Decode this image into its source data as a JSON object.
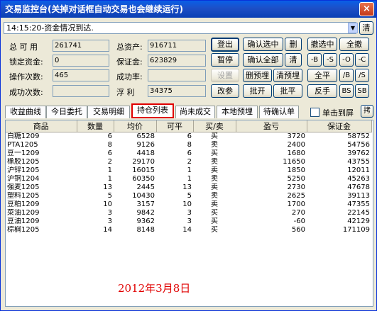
{
  "window": {
    "title": "交易监控台(关掉对话框自动交易也会继续运行)",
    "close_label": "×"
  },
  "status": {
    "text": "14:15:20-资金情况到达.",
    "clear_label": "清"
  },
  "account": {
    "available_label": "总 可 用",
    "available_value": "261741",
    "locked_label": "锁定资金:",
    "locked_value": "0",
    "ops_label": "操作次数:",
    "ops_value": "465",
    "success_label": "成功次数:",
    "success_value": "",
    "total_assets_label": "总资产:",
    "total_assets_value": "916711",
    "margin_label": "保证金:",
    "margin_value": "623829",
    "success_rate_label": "成功率:",
    "success_rate_value": "",
    "float_pnl_label": "浮  利",
    "float_pnl_value": "34375"
  },
  "buttons": {
    "login": "登出",
    "pause": "暂停",
    "settings": "设置",
    "change_params": "改参",
    "confirm_selected": "确认选中",
    "delete": "删",
    "confirm_all": "确认全部",
    "clear": "清",
    "delete_presets": "删预埋",
    "clear_presets": "清预埋",
    "batch_open": "批开",
    "batch_close": "批平",
    "cancel_selected": "撤选中",
    "cancel_all": "全撤",
    "minus_b": "-B",
    "minus_s": "-S",
    "minus_o": "-O",
    "minus_c": "-C",
    "close_all": "全平",
    "slash_b": "/B",
    "slash_s": "/S",
    "reverse": "反手",
    "bs": "BS",
    "sb": "SB"
  },
  "tabs": [
    {
      "label": "收益曲线"
    },
    {
      "label": "今日委托"
    },
    {
      "label": "交易明细"
    },
    {
      "label": "持仓列表"
    },
    {
      "label": "尚未成交"
    },
    {
      "label": "本地预埋"
    },
    {
      "label": "待确认单"
    }
  ],
  "single_sheet_label": "单击到屏",
  "pin_label": "拷",
  "table": {
    "columns": [
      "商品",
      "数量",
      "均价",
      "可平",
      "买/卖",
      "盈亏",
      "保证金"
    ],
    "rows": [
      [
        "白糖1209",
        "6",
        "6528",
        "6",
        "买",
        "3720",
        "58752"
      ],
      [
        "PTA1205",
        "8",
        "9126",
        "8",
        "卖",
        "2400",
        "54756"
      ],
      [
        "豆一1209",
        "6",
        "4418",
        "6",
        "买",
        "1680",
        "39762"
      ],
      [
        "橡胶1205",
        "2",
        "29170",
        "2",
        "卖",
        "11650",
        "43755"
      ],
      [
        "沪锌1205",
        "1",
        "16015",
        "1",
        "卖",
        "1850",
        "12011"
      ],
      [
        "沪铜1204",
        "1",
        "60350",
        "1",
        "卖",
        "5250",
        "45263"
      ],
      [
        "强麦1205",
        "13",
        "2445",
        "13",
        "卖",
        "2730",
        "47678"
      ],
      [
        "塑料1205",
        "5",
        "10430",
        "5",
        "卖",
        "2625",
        "39113"
      ],
      [
        "豆粕1209",
        "10",
        "3157",
        "10",
        "卖",
        "1700",
        "47355"
      ],
      [
        "菜油1209",
        "3",
        "9842",
        "3",
        "买",
        "270",
        "22145"
      ],
      [
        "豆油1209",
        "3",
        "9362",
        "3",
        "买",
        "-60",
        "42129"
      ],
      [
        "棕榈1205",
        "14",
        "8148",
        "14",
        "买",
        "560",
        "171109"
      ]
    ]
  },
  "annotation": "2012年3月8日",
  "colors": {
    "title_bar": "#0a5fe6",
    "annotation": "#e00000",
    "active_tab_border": "#e00000"
  }
}
